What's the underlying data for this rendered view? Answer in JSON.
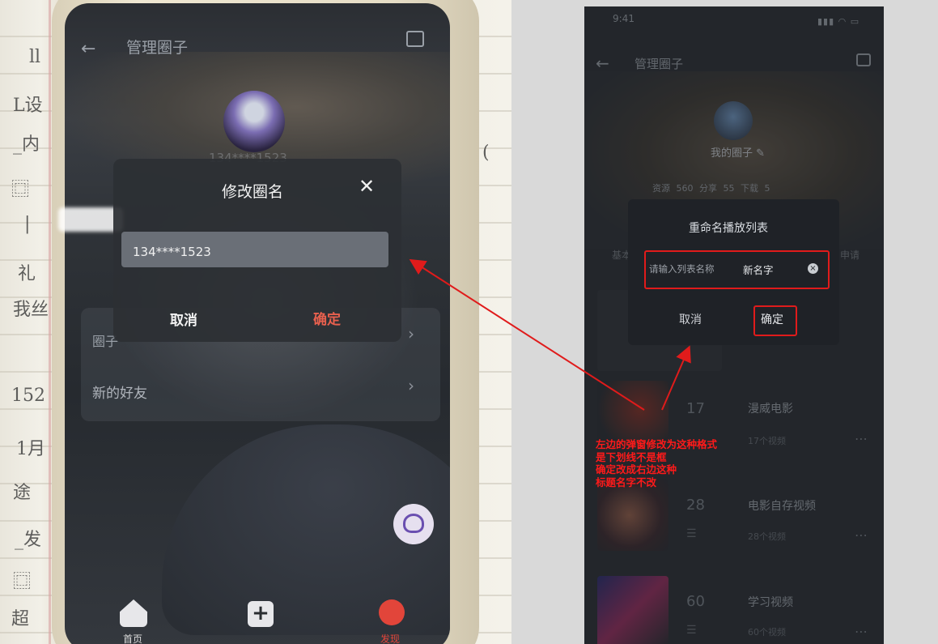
{
  "left_phone": {
    "header_title": "管理圈子",
    "dialog_title": "修改圈名",
    "dialog_input_value": "134****1523",
    "dialog_cancel": "取消",
    "dialog_confirm": "确定",
    "list_circle_label": "圈子",
    "list_new_friends": "新的好友",
    "tab_home": "首页",
    "tab_add": "+",
    "tab_discover": "发现",
    "phone_under_avatar": "134****1523",
    "colors": {
      "confirm_red": "#e8604e",
      "discover_red": "#e2453a"
    }
  },
  "right_mockup": {
    "status_time": "9:41",
    "header_title": "管理圈子",
    "circle_name": "我的圈子",
    "stats": "资源 560   分享 55   下载 5",
    "tabs_left": "基本",
    "tabs_right": "申请",
    "dialog": {
      "title": "重命名播放列表",
      "input_placeholder": "请输入列表名称",
      "input_value": "新名字",
      "cancel": "取消",
      "confirm": "确定"
    },
    "rows": [
      {
        "count": "17",
        "title": "漫威电影",
        "subtitle": "17个视频"
      },
      {
        "count": "28",
        "title": "电影自存视频",
        "subtitle": "28个视频"
      },
      {
        "count": "60",
        "title": "学习视频",
        "subtitle": "60个视频"
      }
    ],
    "more_icon": "⋯"
  },
  "annotation": {
    "line1": "左边的弹窗修改为这种格式",
    "line2": "是下划线不是框",
    "line3": "确定改成右边这种",
    "line4": "标题名字不改",
    "color": "#ff1a1a"
  }
}
